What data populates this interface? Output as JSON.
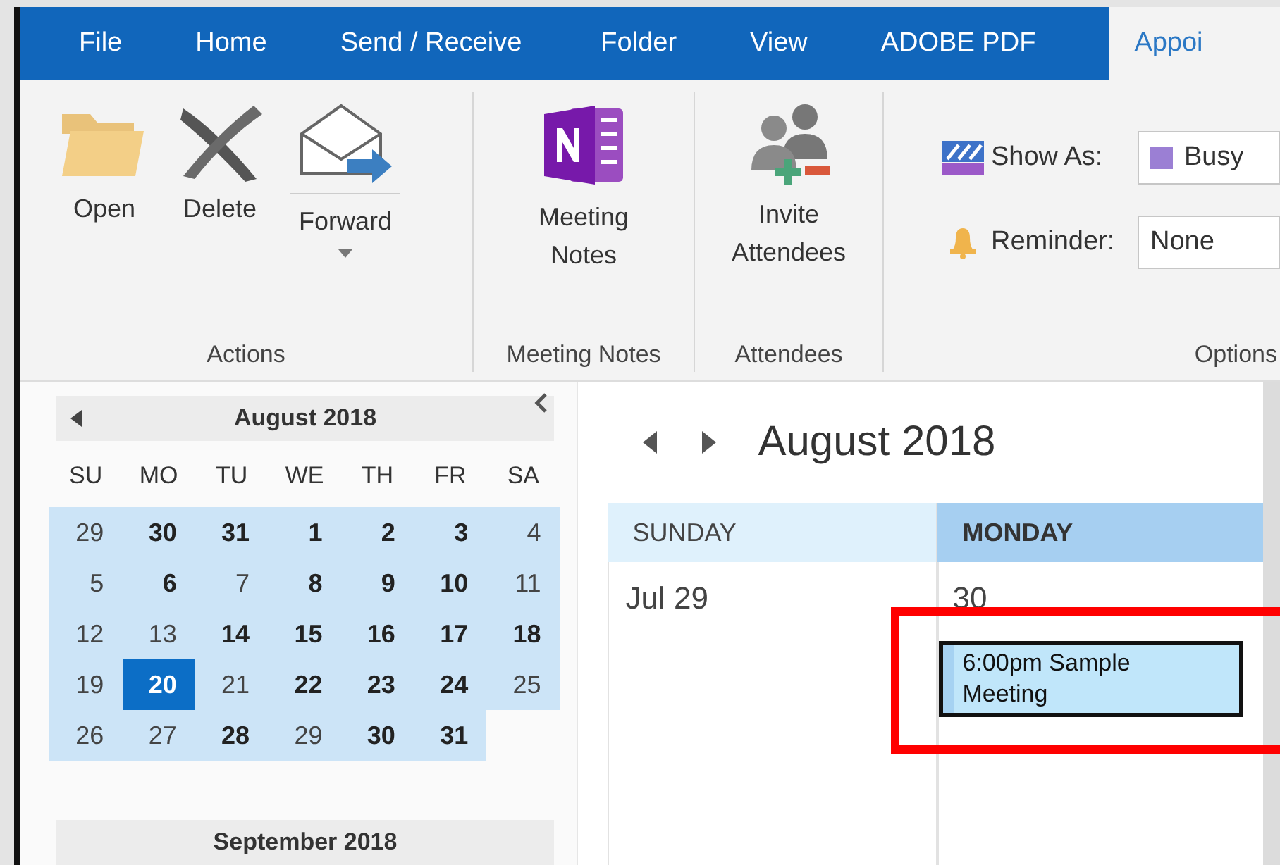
{
  "tabs": [
    {
      "label": "File",
      "selected": false
    },
    {
      "label": "Home",
      "selected": false
    },
    {
      "label": "Send / Receive",
      "selected": false
    },
    {
      "label": "Folder",
      "selected": false
    },
    {
      "label": "View",
      "selected": false
    },
    {
      "label": "ADOBE PDF",
      "selected": false
    },
    {
      "label": "Appoi",
      "selected": true
    }
  ],
  "ribbon": {
    "groups": [
      {
        "label": "Actions",
        "kind": "buttons",
        "buttons": [
          {
            "label": "Open",
            "dropdown": false
          },
          {
            "label": "Delete",
            "dropdown": false
          },
          {
            "label": "Forward",
            "dropdown": true
          }
        ]
      },
      {
        "label": "Meeting Notes",
        "kind": "buttons",
        "buttons": [
          {
            "label": "Meeting Notes",
            "dropdown": false
          }
        ]
      },
      {
        "label": "Attendees",
        "kind": "buttons",
        "buttons": [
          {
            "label": "Invite Attendees",
            "dropdown": false
          }
        ]
      },
      {
        "label": "Options",
        "kind": "fields",
        "fields": [
          {
            "label": "Show As:",
            "value": "Busy",
            "color": "#9b7fd4"
          },
          {
            "label": "Reminder:",
            "value": "None"
          }
        ]
      }
    ]
  },
  "mini_calendar": {
    "month": "August 2018",
    "weekdays": [
      "SU",
      "MO",
      "TU",
      "WE",
      "TH",
      "FR",
      "SA"
    ],
    "weeks": [
      [
        {
          "label": "29",
          "bold": false,
          "today": false
        },
        {
          "label": "30",
          "bold": true,
          "today": false
        },
        {
          "label": "31",
          "bold": true,
          "today": false
        },
        {
          "label": "1",
          "bold": true,
          "today": false
        },
        {
          "label": "2",
          "bold": true,
          "today": false
        },
        {
          "label": "3",
          "bold": true,
          "today": false
        },
        {
          "label": "4",
          "bold": false,
          "today": false
        }
      ],
      [
        {
          "label": "5",
          "bold": false,
          "today": false
        },
        {
          "label": "6",
          "bold": true,
          "today": false
        },
        {
          "label": "7",
          "bold": false,
          "today": false
        },
        {
          "label": "8",
          "bold": true,
          "today": false
        },
        {
          "label": "9",
          "bold": true,
          "today": false
        },
        {
          "label": "10",
          "bold": true,
          "today": false
        },
        {
          "label": "11",
          "bold": false,
          "today": false
        }
      ],
      [
        {
          "label": "12",
          "bold": false,
          "today": false
        },
        {
          "label": "13",
          "bold": false,
          "today": false
        },
        {
          "label": "14",
          "bold": true,
          "today": false
        },
        {
          "label": "15",
          "bold": true,
          "today": false
        },
        {
          "label": "16",
          "bold": true,
          "today": false
        },
        {
          "label": "17",
          "bold": true,
          "today": false
        },
        {
          "label": "18",
          "bold": true,
          "today": false
        }
      ],
      [
        {
          "label": "19",
          "bold": false,
          "today": false
        },
        {
          "label": "20",
          "bold": true,
          "today": true
        },
        {
          "label": "21",
          "bold": false,
          "today": false
        },
        {
          "label": "22",
          "bold": true,
          "today": false
        },
        {
          "label": "23",
          "bold": true,
          "today": false
        },
        {
          "label": "24",
          "bold": true,
          "today": false
        },
        {
          "label": "25",
          "bold": false,
          "today": false
        }
      ],
      [
        {
          "label": "26",
          "bold": false,
          "today": false
        },
        {
          "label": "27",
          "bold": false,
          "today": false
        },
        {
          "label": "28",
          "bold": true,
          "today": false
        },
        {
          "label": "29",
          "bold": false,
          "today": false
        },
        {
          "label": "30",
          "bold": true,
          "today": false
        },
        {
          "label": "31",
          "bold": true,
          "today": false
        }
      ]
    ],
    "next_month": "September 2018"
  },
  "calendar": {
    "title": "August 2018",
    "days": [
      {
        "name": "SUNDAY",
        "date": "Jul 29",
        "selected": false
      },
      {
        "name": "MONDAY",
        "date": "30",
        "selected": true,
        "events": [
          {
            "text": "6:00pm Sample Meeting",
            "highlighted": true
          }
        ]
      }
    ]
  }
}
